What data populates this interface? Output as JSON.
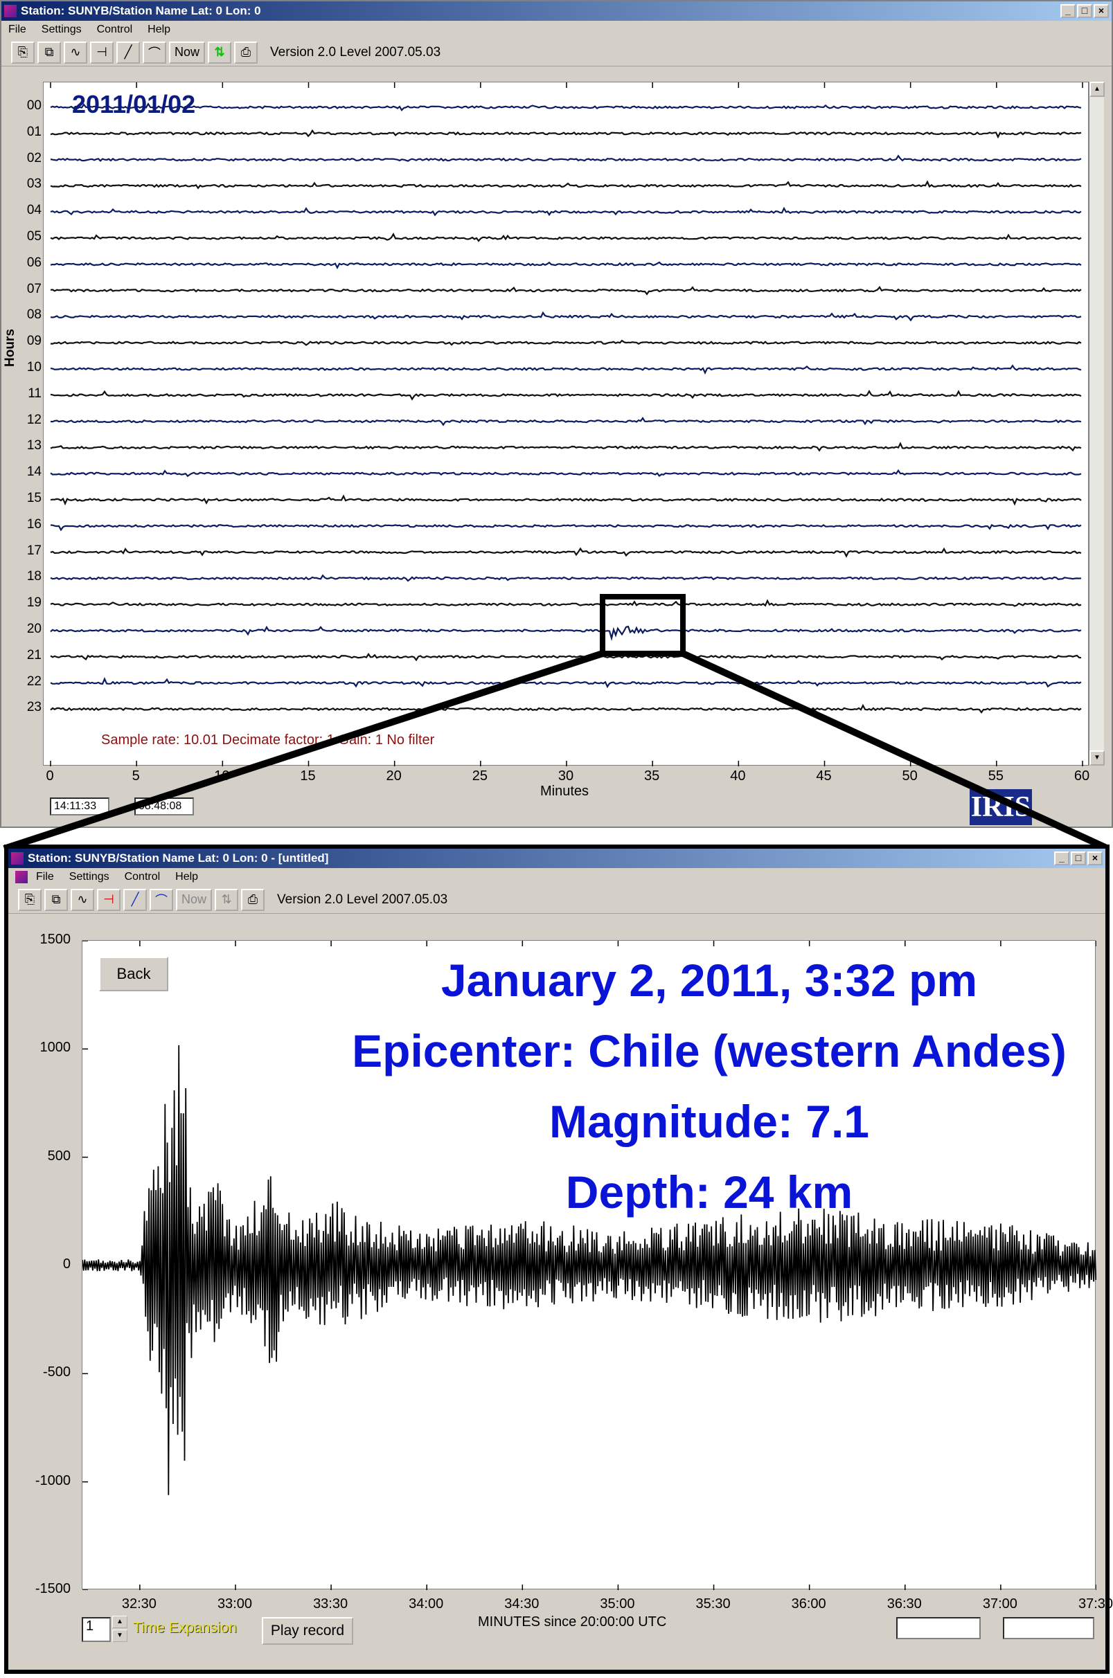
{
  "window1": {
    "title": "Station: SUNYB/Station Name Lat: 0 Lon: 0",
    "menu": [
      "File",
      "Settings",
      "Control",
      "Help"
    ],
    "toolbar": {
      "now_label": "Now",
      "version": "Version 2.0 Level 2007.05.03"
    },
    "controls": [
      "_",
      "□",
      "×"
    ]
  },
  "helicorder": {
    "date": "2011/01/02",
    "hours_label": "Hours",
    "hours": [
      "00",
      "01",
      "02",
      "03",
      "04",
      "05",
      "06",
      "07",
      "08",
      "09",
      "10",
      "11",
      "12",
      "13",
      "14",
      "15",
      "16",
      "17",
      "18",
      "19",
      "20",
      "21",
      "22",
      "23"
    ],
    "x_ticks": [
      "0",
      "5",
      "10",
      "15",
      "20",
      "25",
      "30",
      "35",
      "40",
      "45",
      "50",
      "55",
      "60"
    ],
    "x_label": "Minutes",
    "sample_info": "Sample rate: 10.01  Decimate factor: 1  Gain: 1  No filter",
    "time_left": "14:11:33",
    "time_right": "08:48:08",
    "logo": "IRIS",
    "event_hour_index": 20,
    "event_start_minute": 32.5,
    "event_end_minute": 36.5
  },
  "window2": {
    "title": "Station: SUNYB/Station Name Lat: 0 Lon: 0 - [untitled]",
    "menu": [
      "File",
      "Settings",
      "Control",
      "Help"
    ],
    "toolbar": {
      "now_label": "Now",
      "version": "Version 2.0 Level 2007.05.03"
    },
    "controls": [
      "_",
      "□",
      "×"
    ]
  },
  "zoom": {
    "back_label": "Back",
    "info": [
      "January 2, 2011, 3:32 pm",
      "Epicenter: Chile (western Andes)",
      "Magnitude: 7.1",
      "Depth: 24 km"
    ],
    "spin_value": "1",
    "time_expansion_label": "Time Expansion",
    "play_label": "Play record",
    "x_axis_title": "MINUTES since 20:00:00 UTC"
  },
  "chart_data": {
    "type": "line",
    "ylim": [
      -1500,
      1500
    ],
    "yticks": [
      "1500",
      "1000",
      "500",
      "0",
      "-500",
      "-1000",
      "-1500"
    ],
    "xticks": [
      "32:30",
      "33:00",
      "33:30",
      "34:00",
      "34:30",
      "35:00",
      "35:30",
      "36:00",
      "36:30",
      "37:00",
      "37:30"
    ],
    "xlim_minutes": [
      32.2,
      37.5
    ],
    "series": [
      {
        "x_minutes": [
          32.2,
          32.4,
          32.5,
          32.52,
          32.55,
          32.58,
          32.6,
          32.63,
          32.66,
          32.7,
          32.73,
          32.75,
          32.78,
          32.8,
          32.85,
          32.9,
          33.0,
          33.1,
          33.2,
          33.3,
          33.5,
          33.8,
          34.0,
          34.5,
          35.0,
          35.5,
          36.0,
          36.5,
          37.0,
          37.5
        ],
        "y": [
          0,
          5,
          -20,
          200,
          -480,
          380,
          -600,
          1080,
          -950,
          1120,
          -1000,
          600,
          -400,
          280,
          -300,
          420,
          -180,
          300,
          -460,
          200,
          280,
          -180,
          150,
          -200,
          140,
          -200,
          260,
          -200,
          180,
          90
        ]
      }
    ]
  }
}
